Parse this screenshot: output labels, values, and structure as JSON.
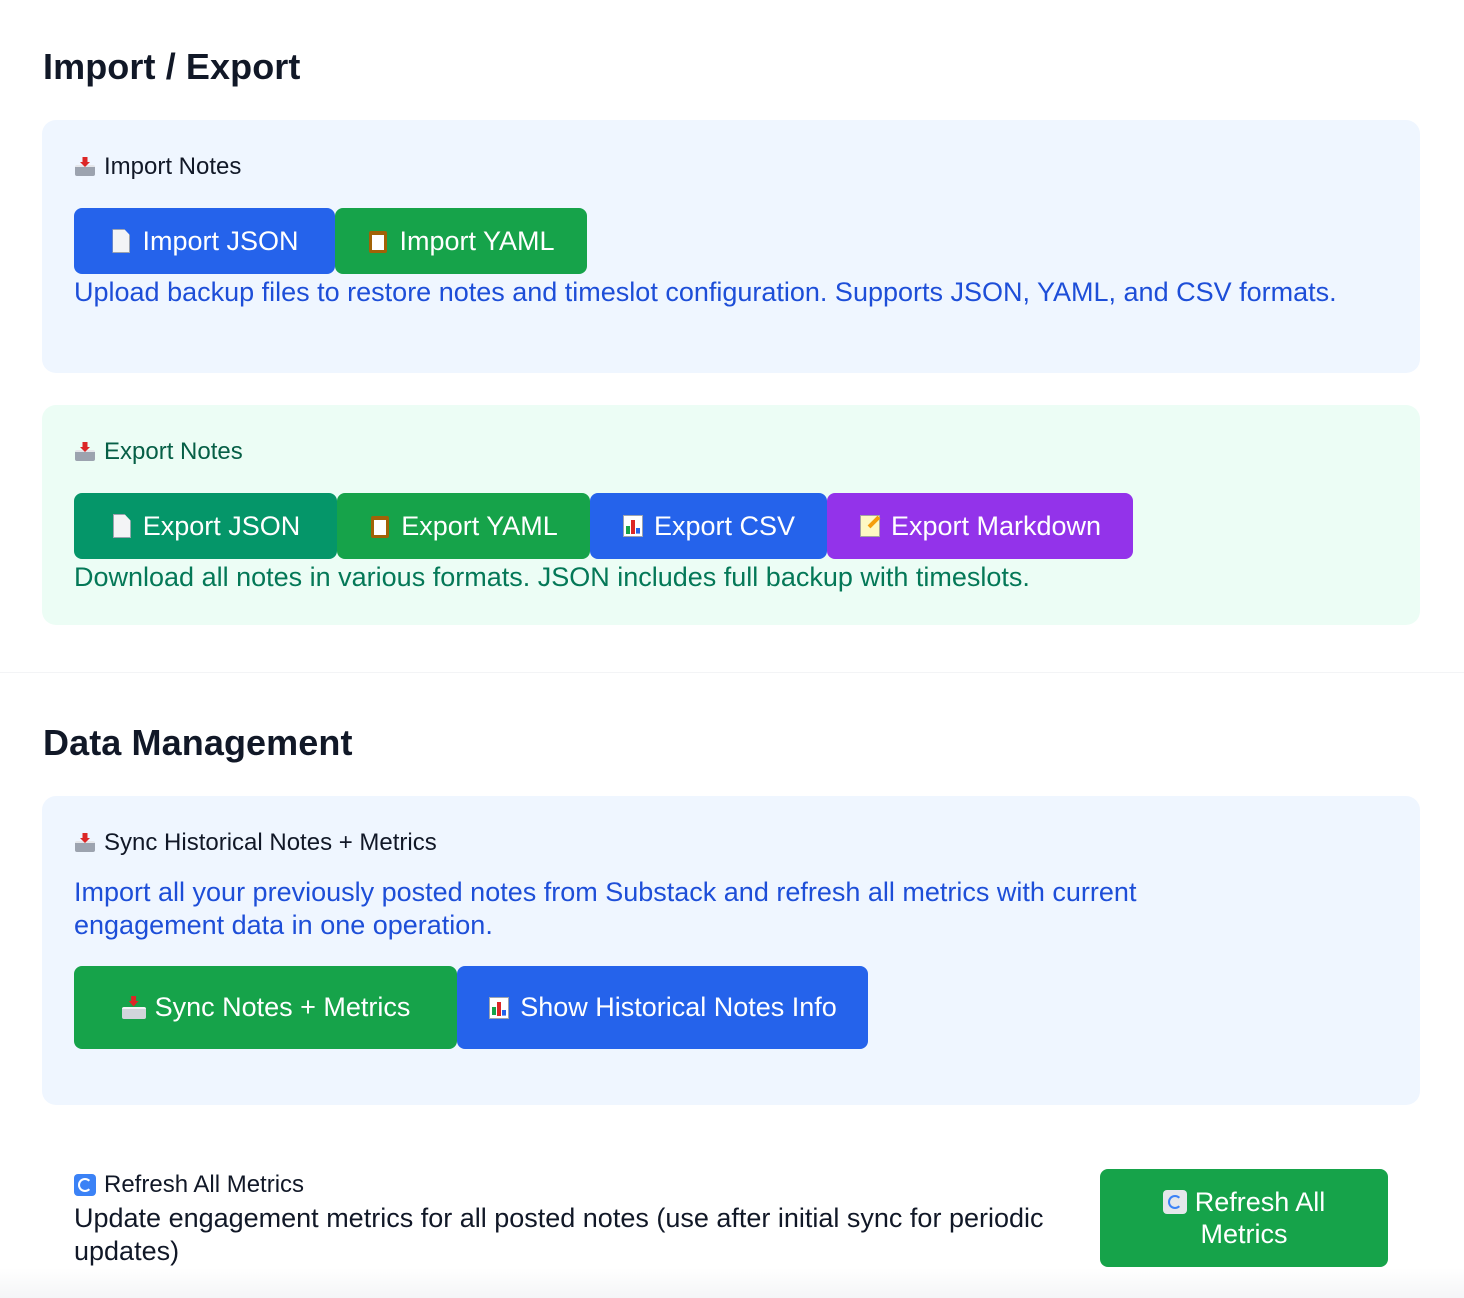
{
  "import_export": {
    "title": "Import / Export",
    "import_card": {
      "heading": "Import Notes",
      "heading_icon": "inbox-tray-icon",
      "buttons": [
        {
          "label": "Import JSON",
          "icon": "document-icon",
          "color": "#2563eb"
        },
        {
          "label": "Import YAML",
          "icon": "clipboard-icon",
          "color": "#16a34a"
        }
      ],
      "description": "Upload backup files to restore notes and timeslot configuration. Supports JSON, YAML, and CSV formats."
    },
    "export_card": {
      "heading": "Export Notes",
      "heading_icon": "outbox-tray-icon",
      "buttons": [
        {
          "label": "Export JSON",
          "icon": "document-icon",
          "color": "#059669"
        },
        {
          "label": "Export YAML",
          "icon": "clipboard-icon",
          "color": "#16a34a"
        },
        {
          "label": "Export CSV",
          "icon": "bar-chart-icon",
          "color": "#2563eb"
        },
        {
          "label": "Export Markdown",
          "icon": "memo-icon",
          "color": "#9333ea"
        }
      ],
      "description": "Download all notes in various formats. JSON includes full backup with timeslots."
    }
  },
  "data_management": {
    "title": "Data Management",
    "sync_card": {
      "heading": "Sync Historical Notes + Metrics",
      "heading_icon": "inbox-tray-icon",
      "description": "Import all your previously posted notes from Substack and refresh all metrics with current engagement data in one operation.",
      "buttons": [
        {
          "label": "Sync Notes + Metrics",
          "icon": "inbox-tray-icon",
          "color": "#16a34a"
        },
        {
          "label": "Show Historical Notes Info",
          "icon": "bar-chart-icon",
          "color": "#2563eb"
        }
      ]
    },
    "refresh": {
      "heading": "Refresh All Metrics",
      "heading_icon": "refresh-icon",
      "description": "Update engagement metrics for all posted notes (use after initial sync for periodic updates)",
      "button_label": "Refresh All Metrics",
      "button_icon": "refresh-icon",
      "button_color": "#16a34a"
    }
  }
}
